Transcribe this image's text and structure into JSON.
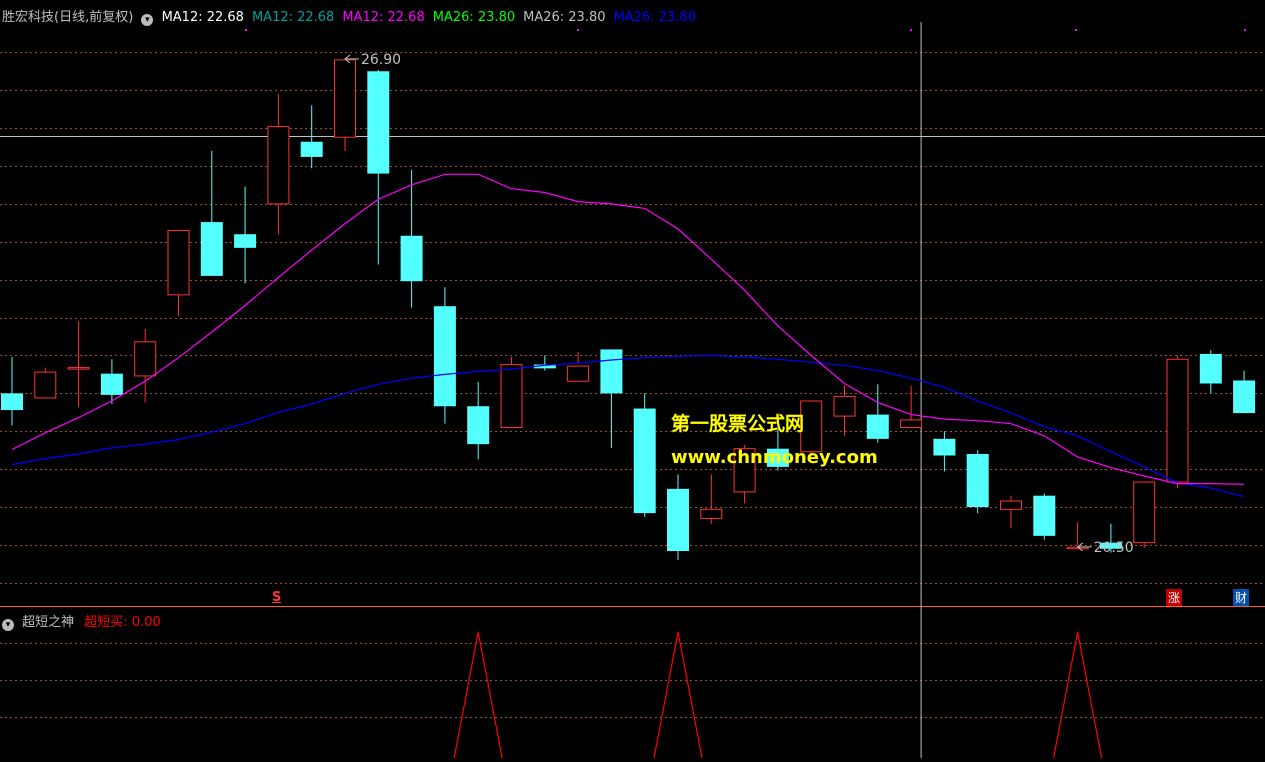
{
  "header": {
    "stock_label": "胜宏科技(日线,前复权)",
    "stock_label_color": "#c0c0c0",
    "ma_readouts": [
      {
        "text": "MA12: 22.68",
        "color": "#ffffff"
      },
      {
        "text": "MA12: 22.68",
        "color": "#00a0a0"
      },
      {
        "text": "MA12: 22.68",
        "color": "#ff00ff"
      },
      {
        "text": "MA26: 23.80",
        "color": "#00ff00"
      },
      {
        "text": "MA26: 23.80",
        "color": "#c0c0c0"
      },
      {
        "text": "MA26: 23.80",
        "color": "#0000ff"
      }
    ]
  },
  "indicator_panel": {
    "name": "超短之神",
    "buy_label": "超短买: 0.00",
    "name_color": "#c0c0c0",
    "buy_color": "#ff0000"
  },
  "watermark": {
    "line1": "第一股票公式网",
    "line2": "www.chnmoney.com"
  },
  "markers": {
    "s_label": "S",
    "zhang_label": "涨",
    "cai_label": "财"
  },
  "colors": {
    "background": "#000000",
    "up_candle": "#ff3232",
    "down_candle": "#54ffff",
    "ma12": "#ff00ff",
    "ma26": "#0000ff",
    "grid": "#a0522d",
    "separator": "#ff6600",
    "crosshair": "#c0c0c0",
    "indicator": "#ff0000",
    "label": "#c0c0c0"
  },
  "chart_data": [
    {
      "type": "candlestick",
      "title": "胜宏科技(日线,前复权)",
      "ylim": [
        19.8,
        27.4
      ],
      "grid": true,
      "crosshair_price": 25.9,
      "annotations": [
        {
          "text": "26.90",
          "candle_index": 10,
          "price": 26.9
        },
        {
          "text": "20.50",
          "candle_index": 32,
          "price": 20.5
        }
      ],
      "candles": [
        {
          "o": 22.5,
          "h": 22.98,
          "l": 22.08,
          "c": 22.28
        },
        {
          "o": 22.44,
          "h": 22.84,
          "l": 22.48,
          "c": 22.78
        },
        {
          "o": 22.84,
          "h": 23.45,
          "l": 22.32,
          "c": 22.84
        },
        {
          "o": 22.76,
          "h": 22.95,
          "l": 22.36,
          "c": 22.48
        },
        {
          "o": 22.73,
          "h": 23.35,
          "l": 22.38,
          "c": 23.18
        },
        {
          "o": 23.8,
          "h": 24.5,
          "l": 23.52,
          "c": 24.65
        },
        {
          "o": 24.76,
          "h": 25.7,
          "l": 24.48,
          "c": 24.05
        },
        {
          "o": 24.6,
          "h": 25.23,
          "l": 23.95,
          "c": 24.42
        },
        {
          "o": 25.0,
          "h": 26.45,
          "l": 24.6,
          "c": 26.02
        },
        {
          "o": 25.82,
          "h": 26.3,
          "l": 25.47,
          "c": 25.62
        },
        {
          "o": 25.88,
          "h": 26.86,
          "l": 25.7,
          "c": 26.9
        },
        {
          "o": 26.75,
          "h": 26.77,
          "l": 24.2,
          "c": 25.4
        },
        {
          "o": 24.58,
          "h": 25.45,
          "l": 23.63,
          "c": 23.98
        },
        {
          "o": 23.65,
          "h": 23.9,
          "l": 22.1,
          "c": 22.33
        },
        {
          "o": 22.33,
          "h": 22.65,
          "l": 21.63,
          "c": 21.83
        },
        {
          "o": 22.05,
          "h": 22.98,
          "l": 22.2,
          "c": 22.88
        },
        {
          "o": 22.88,
          "h": 23.0,
          "l": 22.8,
          "c": 22.83
        },
        {
          "o": 22.66,
          "h": 23.05,
          "l": 22.9,
          "c": 22.86
        },
        {
          "o": 23.08,
          "h": 23.08,
          "l": 21.78,
          "c": 22.5
        },
        {
          "o": 22.3,
          "h": 22.5,
          "l": 20.87,
          "c": 20.92
        },
        {
          "o": 21.24,
          "h": 21.43,
          "l": 20.3,
          "c": 20.42
        },
        {
          "o": 20.85,
          "h": 21.43,
          "l": 20.78,
          "c": 20.97
        },
        {
          "o": 21.2,
          "h": 21.82,
          "l": 21.05,
          "c": 21.77
        },
        {
          "o": 21.77,
          "h": 22.05,
          "l": 21.48,
          "c": 21.53
        },
        {
          "o": 21.73,
          "h": 22.4,
          "l": 21.7,
          "c": 22.4
        },
        {
          "o": 22.2,
          "h": 22.6,
          "l": 21.94,
          "c": 22.46
        },
        {
          "o": 22.22,
          "h": 22.62,
          "l": 21.85,
          "c": 21.9
        },
        {
          "o": 22.05,
          "h": 22.6,
          "l": 22.1,
          "c": 22.15
        },
        {
          "o": 21.9,
          "h": 22.0,
          "l": 21.47,
          "c": 21.68
        },
        {
          "o": 21.7,
          "h": 21.75,
          "l": 20.92,
          "c": 21.0
        },
        {
          "o": 20.97,
          "h": 21.15,
          "l": 20.72,
          "c": 21.08
        },
        {
          "o": 21.15,
          "h": 21.18,
          "l": 20.57,
          "c": 20.62
        },
        {
          "o": 20.47,
          "h": 20.8,
          "l": 20.5,
          "c": 20.47
        },
        {
          "o": 20.53,
          "h": 20.78,
          "l": 20.4,
          "c": 20.45
        },
        {
          "o": 20.53,
          "h": 21.33,
          "l": 20.46,
          "c": 21.33
        },
        {
          "o": 21.33,
          "h": 23.0,
          "l": 21.25,
          "c": 22.95
        },
        {
          "o": 23.02,
          "h": 23.07,
          "l": 22.5,
          "c": 22.63
        },
        {
          "o": 22.67,
          "h": 22.8,
          "l": 22.24,
          "c": 22.24
        }
      ],
      "ma12": [
        21.76,
        21.98,
        22.18,
        22.4,
        22.66,
        22.97,
        23.31,
        23.66,
        24.03,
        24.39,
        24.74,
        25.06,
        25.25,
        25.39,
        25.39,
        25.2,
        25.15,
        25.03,
        25.0,
        24.94,
        24.67,
        24.27,
        23.86,
        23.39,
        23.0,
        22.63,
        22.38,
        22.22,
        22.16,
        22.14,
        22.1,
        21.94,
        21.66,
        21.52,
        21.41,
        21.31,
        21.31,
        21.3
      ],
      "ma26": [
        21.56,
        21.64,
        21.7,
        21.78,
        21.83,
        21.89,
        21.99,
        22.1,
        22.25,
        22.36,
        22.5,
        22.62,
        22.7,
        22.75,
        22.79,
        22.82,
        22.87,
        22.9,
        22.94,
        22.97,
        22.99,
        23.0,
        22.98,
        22.95,
        22.91,
        22.87,
        22.8,
        22.7,
        22.58,
        22.4,
        22.24,
        22.06,
        21.94,
        21.73,
        21.53,
        21.32,
        21.25,
        21.14
      ]
    },
    {
      "type": "line",
      "title": "超短之神",
      "series": [
        {
          "name": "超短买",
          "spikes_at": [
            14,
            20,
            32
          ]
        }
      ]
    }
  ]
}
